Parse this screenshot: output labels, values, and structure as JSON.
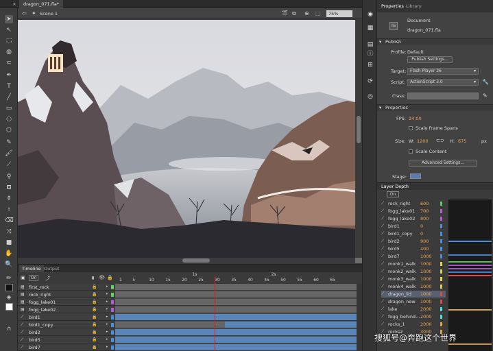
{
  "document": {
    "tab_name": "dragon_071.fla*"
  },
  "editbar": {
    "scene": "Scene 1",
    "zoom": "75%"
  },
  "timeline": {
    "tabs": [
      "Timeline",
      "Output"
    ],
    "on_label": "On",
    "ruler": {
      "frames": [
        "1",
        "5",
        "10",
        "15",
        "20",
        "25",
        "30",
        "35",
        "40",
        "45",
        "50",
        "55",
        "60",
        "65"
      ],
      "seconds": [
        "1s",
        "2s"
      ]
    },
    "current_frame": 30,
    "layers": [
      {
        "name": "first_rock",
        "color": "#5fd35f"
      },
      {
        "name": "rock_right",
        "color": "#5fd35f"
      },
      {
        "name": "fogg_lake01",
        "color": "#b35fd3"
      },
      {
        "name": "fogg_lake02",
        "color": "#b35fd3"
      },
      {
        "name": "bird1",
        "color": "#4a8fe0"
      },
      {
        "name": "bird1_copy",
        "color": "#4a8fe0"
      },
      {
        "name": "bird2",
        "color": "#4a8fe0"
      },
      {
        "name": "bird5",
        "color": "#4a8fe0"
      },
      {
        "name": "bird7",
        "color": "#4a8fe0"
      }
    ]
  },
  "properties": {
    "tabs": [
      "Properties",
      "Library"
    ],
    "doc_type": "Document",
    "doc_name": "dragon_071.fla",
    "publish_header": "Publish",
    "profile_label": "Profile:",
    "profile_value": "Default",
    "publish_settings": "Publish Settings...",
    "target_label": "Target:",
    "target_value": "Flash Player 26",
    "script_label": "Script:",
    "script_value": "ActionScript 3.0",
    "class_label": "Class:",
    "props_header": "Properties",
    "fps_label": "FPS:",
    "fps_value": "24.00",
    "scale_frame_spans": "Scale Frame Spans",
    "size_label": "Size:",
    "w_label": "W:",
    "w_value": "1200",
    "h_label": "H:",
    "h_value": "675",
    "unit": "px",
    "scale_content": "Scale Content",
    "advanced_settings": "Advanced Settings...",
    "stage_label": "Stage:"
  },
  "layer_depth": {
    "title": "Layer Depth",
    "on_label": "On",
    "rows": [
      {
        "name": "rock_right",
        "depth": "600",
        "color": "#5fd35f"
      },
      {
        "name": "fogg_lake01",
        "depth": "700",
        "color": "#b35fd3"
      },
      {
        "name": "fogg_lake02",
        "depth": "800",
        "color": "#b35fd3"
      },
      {
        "name": "bird1",
        "depth": "0",
        "color": "#4a8fe0"
      },
      {
        "name": "bird1_copy",
        "depth": "0",
        "color": "#4a8fe0"
      },
      {
        "name": "bird2",
        "depth": "900",
        "color": "#4a8fe0"
      },
      {
        "name": "bird5",
        "depth": "400",
        "color": "#4a8fe0"
      },
      {
        "name": "bird7",
        "depth": "1000",
        "color": "#4a8fe0"
      },
      {
        "name": "monk1_walk",
        "depth": "1000",
        "color": "#e0d34a"
      },
      {
        "name": "monk2_walk",
        "depth": "1000",
        "color": "#e0d34a"
      },
      {
        "name": "monk3_walk",
        "depth": "1000",
        "color": "#e0d34a"
      },
      {
        "name": "monk4_walk",
        "depth": "1000",
        "color": "#e0d34a"
      },
      {
        "name": "dragon_lid",
        "depth": "1000",
        "color": "#e04a4a"
      },
      {
        "name": "dragon_new",
        "depth": "1000",
        "color": "#e04a4a"
      },
      {
        "name": "lake",
        "depth": "2000",
        "color": "#4ae0d3"
      },
      {
        "name": "fogg_behind...",
        "depth": "2000",
        "color": "#4ae0d3"
      },
      {
        "name": "rocks_1",
        "depth": "2000",
        "color": "#e0a04a"
      },
      {
        "name": "rocks2",
        "depth": "3000",
        "color": "#e0a04a"
      }
    ]
  },
  "watermark": "搜狐号@奔跑这个世界"
}
